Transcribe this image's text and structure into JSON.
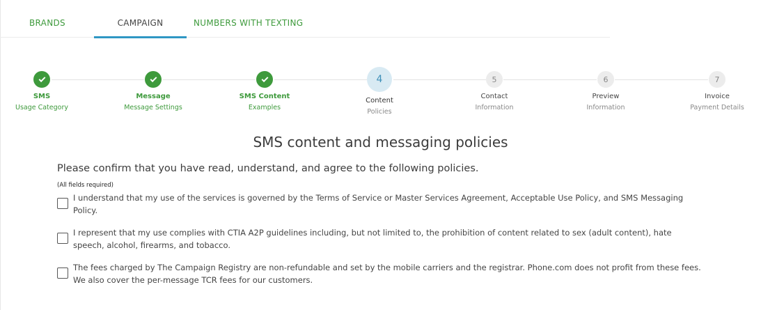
{
  "tabs": [
    {
      "label": "BRANDS"
    },
    {
      "label": "CAMPAIGN"
    },
    {
      "label": "NUMBERS WITH TEXTING"
    }
  ],
  "active_tab": "CAMPAIGN",
  "steps": [
    {
      "number": "1",
      "title": "SMS",
      "subtitle": "Usage Category",
      "status": "complete"
    },
    {
      "number": "2",
      "title": "Message",
      "subtitle": "Message Settings",
      "status": "complete"
    },
    {
      "number": "3",
      "title": "SMS Content",
      "subtitle": "Examples",
      "status": "complete"
    },
    {
      "number": "4",
      "title": "Content",
      "subtitle": "Policies",
      "status": "current"
    },
    {
      "number": "5",
      "title": "Contact",
      "subtitle": "Information",
      "status": "pending"
    },
    {
      "number": "6",
      "title": "Preview",
      "subtitle": "Information",
      "status": "pending"
    },
    {
      "number": "7",
      "title": "Invoice",
      "subtitle": "Payment Details",
      "status": "pending"
    }
  ],
  "main": {
    "heading": "SMS content and messaging policies",
    "confirm_text": "Please confirm that you have read, understand, and agree to the following policies.",
    "required_note": "(All fields required)",
    "policies": [
      {
        "text": "I understand that my use of the services is governed by the Terms of Service or Master Services Agreement, Acceptable Use Policy, and SMS Messaging Policy.",
        "checked": false
      },
      {
        "text": "I represent that my use complies with CTIA A2P guidelines including, but not limited to, the prohibition of content related to sex (adult content), hate speech, alcohol, firearms, and tobacco.",
        "checked": false
      },
      {
        "text": "The fees charged by The Campaign Registry are non-refundable and set by the mobile carriers and the registrar. Phone.com does not profit from these fees. We also cover the per-message TCR fees for our customers.",
        "checked": false
      }
    ]
  },
  "colors": {
    "accent_green": "#3e9a3c",
    "accent_blue": "#2f97c4",
    "current_step_bg": "#d8eaf3"
  }
}
